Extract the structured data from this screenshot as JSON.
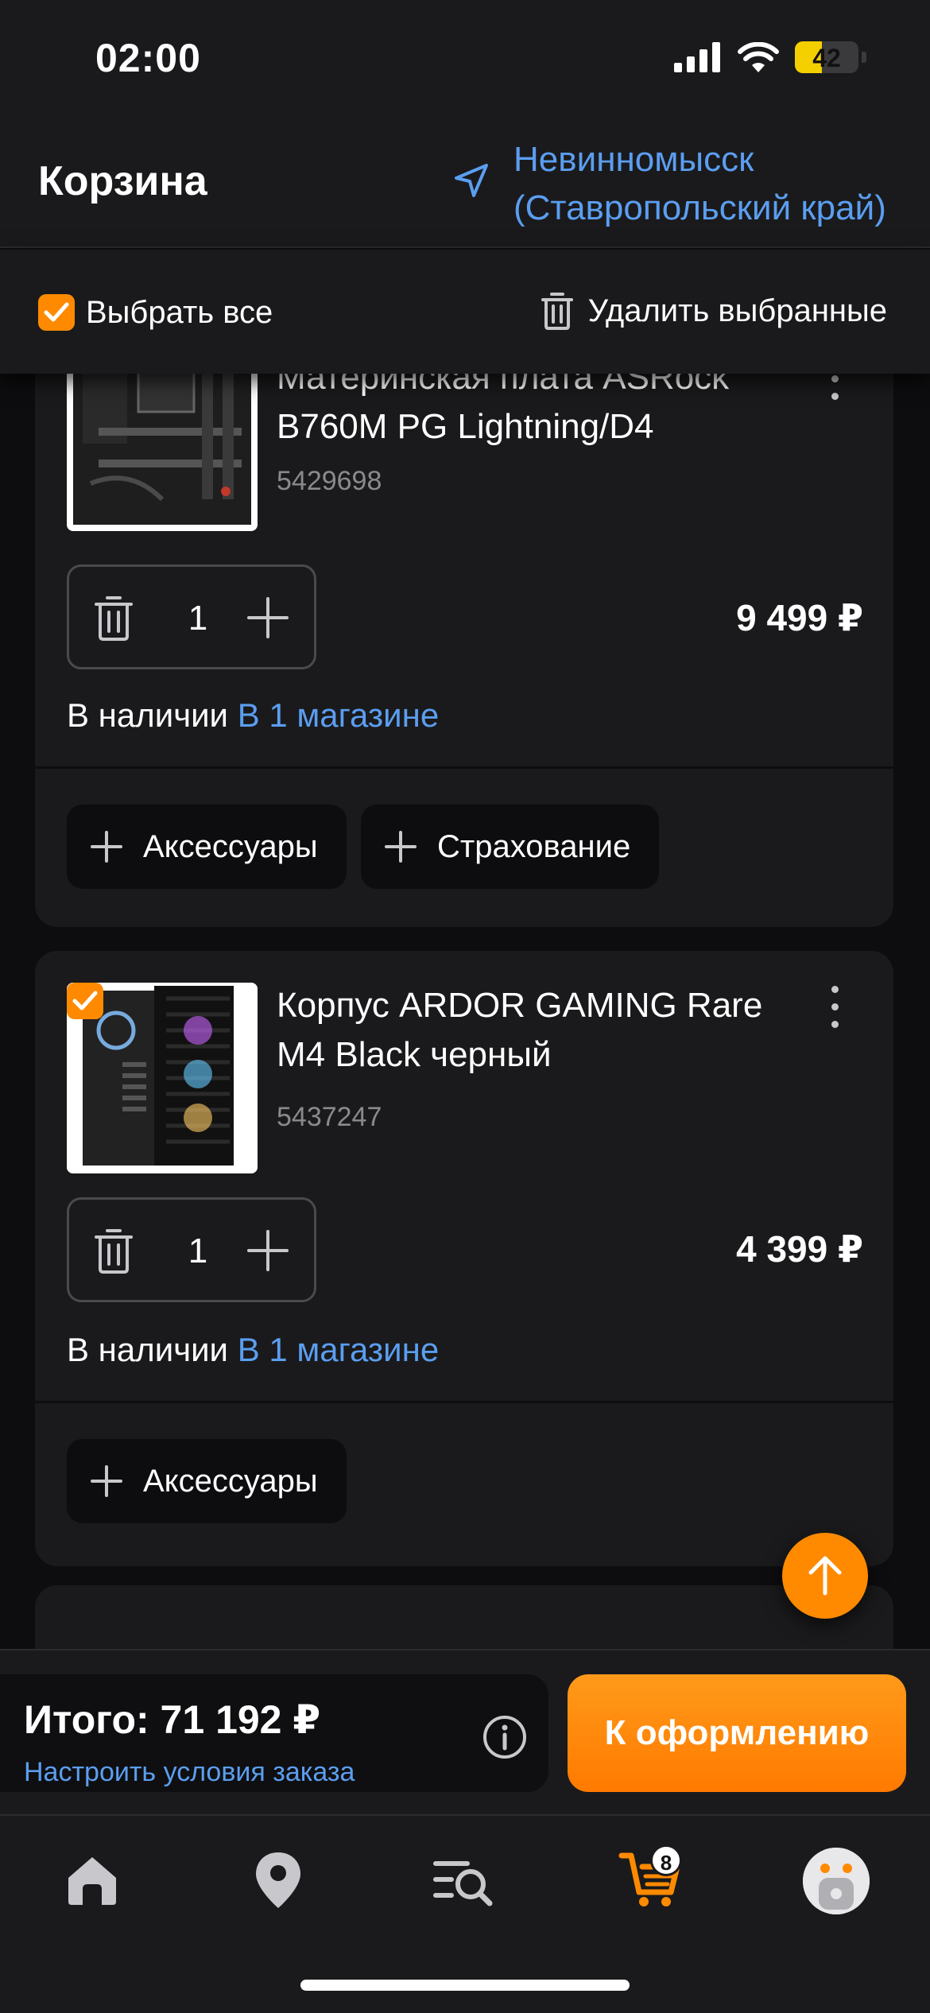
{
  "status_bar": {
    "time": "02:00",
    "battery": "42"
  },
  "header": {
    "title": "Корзина",
    "location_line1": "Невинномысск",
    "location_line2": "(Ставропольский край)"
  },
  "select_bar": {
    "select_all": "Выбрать все",
    "delete_selected": "Удалить выбранные"
  },
  "items": [
    {
      "name_line1": "Материнская плата ASRock",
      "name_line2": "B760M PG Lightning/D4",
      "sku": "5429698",
      "quantity": "1",
      "price": "9 499 ₽",
      "stock_prefix": "В наличии",
      "stock_link": "В 1 магазине",
      "chips": [
        "Аксессуары",
        "Страхование"
      ]
    },
    {
      "name_line1": "Корпус ARDOR GAMING Rare",
      "name_line2": "M4 Black  черный",
      "sku": "5437247",
      "quantity": "1",
      "price": "4 399 ₽",
      "stock_prefix": "В наличии",
      "stock_link": "В 1 магазине",
      "chips": [
        "Аксессуары"
      ]
    }
  ],
  "footer": {
    "total": "Итого: 71 192 ₽",
    "order_terms": "Настроить условия заказа",
    "checkout": "К оформлению"
  },
  "tab_bar": {
    "tabs": [
      "home-icon",
      "map-pin-icon",
      "catalog-search-icon",
      "cart-icon",
      "profile-avatar"
    ],
    "cart_count": "8",
    "accent_color": "#ff8a00"
  },
  "colors": {
    "accent": "#ff8a00",
    "link": "#5b9ef0",
    "background": "#0d0d0f",
    "card": "#1a1a1c"
  }
}
